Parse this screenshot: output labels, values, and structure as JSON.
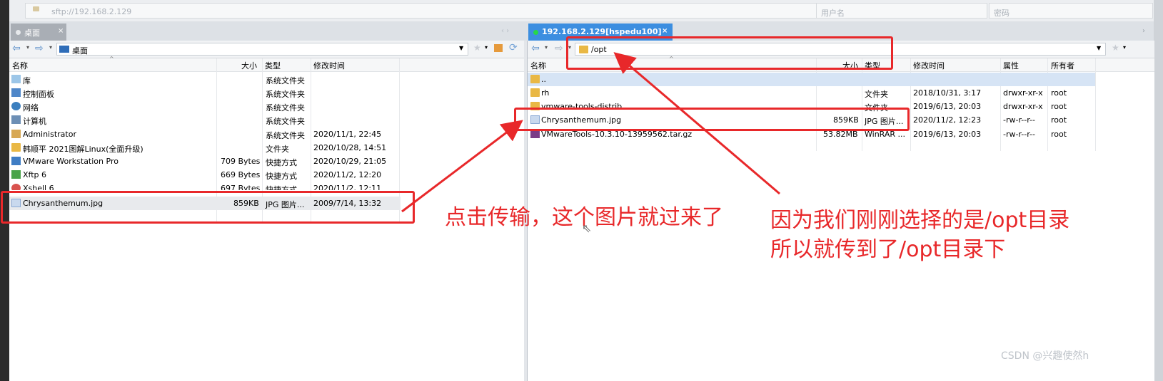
{
  "address": {
    "host_placeholder": "sftp://192.168.2.129",
    "user_placeholder": "用户名",
    "pass_placeholder": "密码"
  },
  "tabs": {
    "left": "桌面",
    "right": "192.168.2.129[hspedu100]"
  },
  "left": {
    "path": "桌面",
    "headers": {
      "name": "名称",
      "size": "大小",
      "type": "类型",
      "mtime": "修改时间"
    },
    "rows": [
      {
        "name": "库",
        "size": "",
        "type": "系统文件夹",
        "mtime": ""
      },
      {
        "name": "控制面板",
        "size": "",
        "type": "系统文件夹",
        "mtime": ""
      },
      {
        "name": "网络",
        "size": "",
        "type": "系统文件夹",
        "mtime": ""
      },
      {
        "name": "计算机",
        "size": "",
        "type": "系统文件夹",
        "mtime": ""
      },
      {
        "name": "Administrator",
        "size": "",
        "type": "系统文件夹",
        "mtime": "2020/11/1, 22:45"
      },
      {
        "name": "韩顺平 2021图解Linux(全面升级)",
        "size": "",
        "type": "文件夹",
        "mtime": "2020/10/28, 14:51"
      },
      {
        "name": "VMware Workstation Pro",
        "size": "709 Bytes",
        "type": "快捷方式",
        "mtime": "2020/10/29, 21:05"
      },
      {
        "name": "Xftp 6",
        "size": "669 Bytes",
        "type": "快捷方式",
        "mtime": "2020/11/2, 12:20"
      },
      {
        "name": "Xshell 6",
        "size": "697 Bytes",
        "type": "快捷方式",
        "mtime": "2020/11/2, 12:11"
      },
      {
        "name": "Chrysanthemum.jpg",
        "size": "859KB",
        "type": "JPG 图片...",
        "mtime": "2009/7/14, 13:32"
      }
    ]
  },
  "right": {
    "path": "/opt",
    "headers": {
      "name": "名称",
      "size": "大小",
      "type": "类型",
      "mtime": "修改时间",
      "perm": "属性",
      "owner": "所有者"
    },
    "rows": [
      {
        "name": "..",
        "size": "",
        "type": "",
        "mtime": "",
        "perm": "",
        "owner": ""
      },
      {
        "name": "rh",
        "size": "",
        "type": "文件夹",
        "mtime": "2018/10/31, 3:17",
        "perm": "drwxr-xr-x",
        "owner": "root"
      },
      {
        "name": "vmware-tools-distrib",
        "size": "",
        "type": "文件夹",
        "mtime": "2019/6/13, 20:03",
        "perm": "drwxr-xr-x",
        "owner": "root"
      },
      {
        "name": "Chrysanthemum.jpg",
        "size": "859KB",
        "type": "JPG 图片...",
        "mtime": "2020/11/2, 12:23",
        "perm": "-rw-r--r--",
        "owner": "root"
      },
      {
        "name": "VMwareTools-10.3.10-13959562.tar.gz",
        "size": "53.82MB",
        "type": "WinRAR ...",
        "mtime": "2019/6/13, 20:03",
        "perm": "-rw-r--r--",
        "owner": "root"
      }
    ]
  },
  "annotations": {
    "left_note": "点击传输，这个图片就过来了",
    "right_note_line1": "因为我们刚刚选择的是/opt目录",
    "right_note_line2": "所以就传到了/opt目录下"
  },
  "watermark": "CSDN @兴趣使然h",
  "colors": {
    "annotation": "#e8282a",
    "active_tab": "#3c8ee0",
    "folder": "#e9b845"
  }
}
